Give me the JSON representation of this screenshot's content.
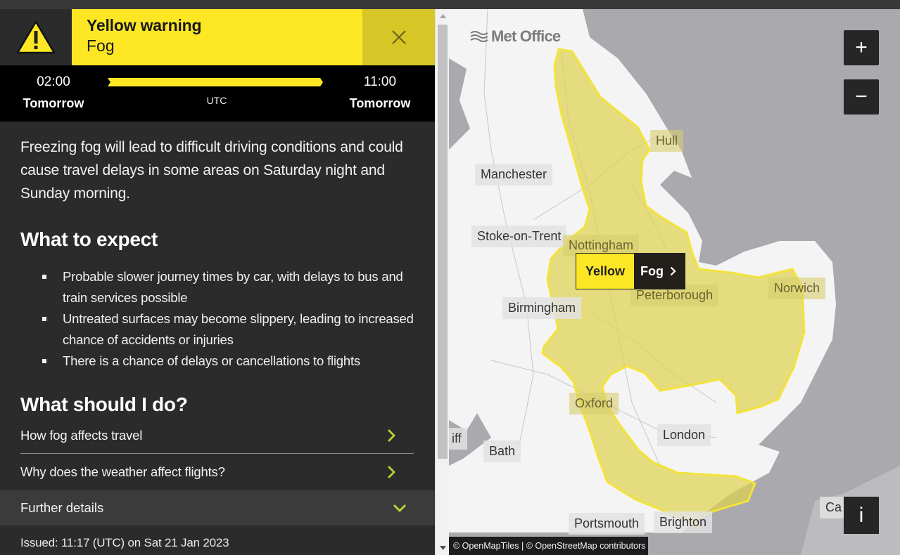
{
  "warning": {
    "level": "Yellow warning",
    "type": "Fog",
    "icon": "warning-triangle-icon",
    "close_icon": "close-icon",
    "colors": {
      "yellow": "#fde725",
      "close_bg": "#d7c726",
      "dark": "#2b2b2b"
    }
  },
  "timeline": {
    "start_time": "02:00",
    "start_day": "Tomorrow",
    "end_time": "11:00",
    "end_day": "Tomorrow",
    "timezone": "UTC"
  },
  "summary": "Freezing fog will lead to difficult driving conditions and could cause travel delays in some areas on Saturday night and Sunday morning.",
  "what_to_expect": {
    "heading": "What to expect",
    "items": [
      "Probable slower journey times by car, with delays to bus and train services possible",
      "Untreated surfaces may become slippery, leading to increased chance of accidents or injuries",
      "There is a chance of delays or cancellations to flights"
    ]
  },
  "what_to_do": {
    "heading": "What should I do?",
    "links": [
      {
        "label": "How fog affects travel",
        "icon": "chevron-right-icon"
      },
      {
        "label": "Why does the weather affect flights?",
        "icon": "chevron-right-icon"
      }
    ]
  },
  "further_details": {
    "label": "Further details",
    "icon": "chevron-down-icon"
  },
  "issued": "Issued: 11:17 (UTC) on Sat 21 Jan 2023",
  "map": {
    "logo": "Met Office",
    "zoom_in": "+",
    "zoom_out": "−",
    "info": "i",
    "attribution": "© OpenMapTiles | © OpenStreetMap contributors",
    "warning_label": {
      "level": "Yellow",
      "type": "Fog"
    },
    "cities": [
      "Hull",
      "Manchester",
      "Stoke-on-Trent",
      "Nottingham",
      "Norwich",
      "Birmingham",
      "Peterborough",
      "Oxford",
      "iff",
      "London",
      "Bath",
      "Portsmouth",
      "Brighton",
      "Ca"
    ]
  }
}
